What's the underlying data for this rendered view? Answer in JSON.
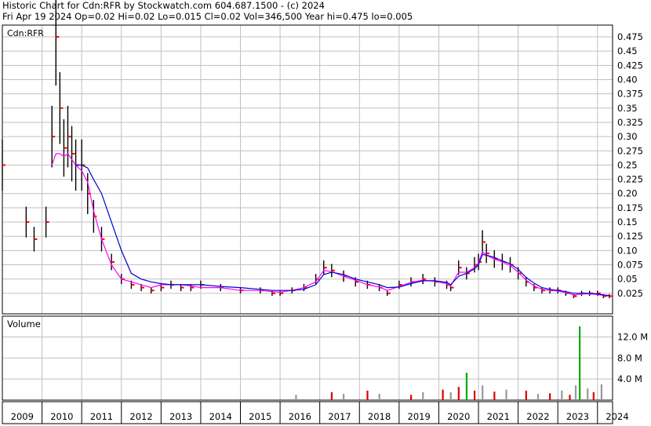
{
  "header": {
    "line1": "Historic Chart for Cdn:RFR by Stockwatch.com 604.687.1500 - (c) 2024",
    "line2": "Fri Apr 19 2024   Op=0.02  Hi=0.02  Lo=0.015  Cl=0.02  Vol=346,500  Year hi=0.475  lo=0.005"
  },
  "symbol_label": "Cdn:RFR",
  "volume_label": "Volume",
  "colors": {
    "grid": "#c0c0c0",
    "frame": "#000000",
    "price_bar": "#000000",
    "price_tick": "#ff0000",
    "ma_short": "#ff00ff",
    "ma_long": "#0000cc",
    "volume_up": "#00aa00",
    "volume_down": "#dd0000",
    "volume_flat": "#999999"
  },
  "chart_data": [
    {
      "type": "line",
      "title": "Historic Chart for Cdn:RFR by Stockwatch.com 604.687.1500 - (c) 2024",
      "ylim": [
        0.0,
        0.5
      ],
      "y_ticks": [
        "0.475",
        "0.45",
        "0.425",
        "0.40",
        "0.375",
        "0.35",
        "0.325",
        "0.30",
        "0.275",
        "0.25",
        "0.225",
        "0.20",
        "0.175",
        "0.15",
        "0.125",
        "0.10",
        "0.075",
        "0.05",
        "0.025"
      ],
      "x_ticks": [
        "2009",
        "2010",
        "2011",
        "2012",
        "2013",
        "2014",
        "2015",
        "2016",
        "2017",
        "2018",
        "2019",
        "2020",
        "2021",
        "2022",
        "2023",
        "2024"
      ],
      "grid": true,
      "x": [
        2009.0,
        2009.6,
        2009.8,
        2010.1,
        2010.25,
        2010.35,
        2010.45,
        2010.55,
        2010.65,
        2010.75,
        2010.85,
        2011.0,
        2011.15,
        2011.3,
        2011.5,
        2011.75,
        2012.0,
        2012.25,
        2012.5,
        2012.75,
        2013.0,
        2013.25,
        2013.5,
        2013.75,
        2014.0,
        2014.5,
        2015.0,
        2015.5,
        2015.8,
        2016.0,
        2016.3,
        2016.6,
        2016.9,
        2017.1,
        2017.3,
        2017.6,
        2017.9,
        2018.2,
        2018.5,
        2018.7,
        2019.0,
        2019.3,
        2019.6,
        2019.9,
        2020.2,
        2020.3,
        2020.5,
        2020.7,
        2020.9,
        2021.0,
        2021.1,
        2021.2,
        2021.4,
        2021.6,
        2021.8,
        2022.0,
        2022.2,
        2022.4,
        2022.6,
        2022.8,
        2023.0,
        2023.2,
        2023.4,
        2023.6,
        2023.8,
        2024.0,
        2024.15,
        2024.3
      ],
      "series": [
        {
          "values": [
            0.25,
            0.15,
            0.12,
            0.15,
            0.3,
            0.475,
            0.35,
            0.28,
            0.3,
            0.27,
            0.25,
            0.25,
            0.2,
            0.16,
            0.12,
            0.08,
            0.05,
            0.04,
            0.035,
            0.03,
            0.035,
            0.04,
            0.035,
            0.035,
            0.04,
            0.035,
            0.03,
            0.03,
            0.025,
            0.025,
            0.03,
            0.035,
            0.05,
            0.07,
            0.065,
            0.055,
            0.045,
            0.04,
            0.035,
            0.025,
            0.04,
            0.045,
            0.05,
            0.045,
            0.04,
            0.035,
            0.07,
            0.06,
            0.075,
            0.08,
            0.115,
            0.095,
            0.085,
            0.08,
            0.075,
            0.06,
            0.045,
            0.035,
            0.03,
            0.03,
            0.03,
            0.025,
            0.02,
            0.025,
            0.025,
            0.025,
            0.02,
            0.02
          ]
        },
        {
          "values": [
            null,
            null,
            null,
            null,
            0.25,
            0.27,
            0.27,
            0.265,
            0.27,
            0.26,
            0.25,
            0.24,
            0.22,
            0.17,
            0.12,
            0.075,
            0.05,
            0.045,
            0.04,
            0.035,
            0.04,
            0.04,
            0.04,
            0.038,
            0.035,
            0.035,
            0.03,
            0.03,
            0.028,
            0.027,
            0.03,
            0.035,
            0.045,
            0.065,
            0.063,
            0.055,
            0.048,
            0.04,
            0.036,
            0.03,
            0.037,
            0.044,
            0.048,
            0.046,
            0.042,
            0.038,
            0.062,
            0.062,
            0.07,
            0.078,
            0.098,
            0.092,
            0.085,
            0.08,
            0.074,
            0.062,
            0.048,
            0.038,
            0.032,
            0.03,
            0.029,
            0.026,
            0.022,
            0.024,
            0.024,
            0.023,
            0.021,
            0.02
          ]
        },
        {
          "values": [
            null,
            null,
            null,
            null,
            null,
            null,
            null,
            null,
            null,
            null,
            0.25,
            0.25,
            0.245,
            0.225,
            0.2,
            0.15,
            0.1,
            0.06,
            0.05,
            0.045,
            0.042,
            0.04,
            0.04,
            0.04,
            0.04,
            0.037,
            0.035,
            0.032,
            0.03,
            0.03,
            0.03,
            0.032,
            0.04,
            0.058,
            0.062,
            0.058,
            0.05,
            0.045,
            0.04,
            0.035,
            0.036,
            0.042,
            0.047,
            0.047,
            0.044,
            0.04,
            0.055,
            0.06,
            0.068,
            0.075,
            0.093,
            0.092,
            0.088,
            0.082,
            0.077,
            0.067,
            0.053,
            0.043,
            0.035,
            0.032,
            0.03,
            0.028,
            0.025,
            0.025,
            0.025,
            0.024,
            0.022,
            0.021
          ]
        }
      ]
    },
    {
      "type": "bar",
      "title": "Volume",
      "y_ticks": [
        "12.0 M",
        "8.0 M",
        "4.0 M"
      ],
      "ylim": [
        0,
        15.5
      ],
      "x_ticks": [
        "2009",
        "2010",
        "2011",
        "2012",
        "2013",
        "2014",
        "2015",
        "2016",
        "2017",
        "2018",
        "2019",
        "2020",
        "2021",
        "2022",
        "2023",
        "2024"
      ],
      "grid": true,
      "x": [
        2016.4,
        2017.3,
        2017.6,
        2018.2,
        2018.5,
        2019.3,
        2019.6,
        2020.1,
        2020.3,
        2020.5,
        2020.7,
        2020.9,
        2021.1,
        2021.4,
        2021.7,
        2022.2,
        2022.5,
        2022.8,
        2023.1,
        2023.3,
        2023.45,
        2023.55,
        2023.75,
        2023.9,
        2024.1
      ],
      "values": [
        1.0,
        1.5,
        1.2,
        1.8,
        1.2,
        1.0,
        1.5,
        2.0,
        1.5,
        2.5,
        5.2,
        1.8,
        2.8,
        1.6,
        2.0,
        1.8,
        1.2,
        1.3,
        1.8,
        1.0,
        2.8,
        14.0,
        2.2,
        1.5,
        3.0
      ]
    }
  ]
}
